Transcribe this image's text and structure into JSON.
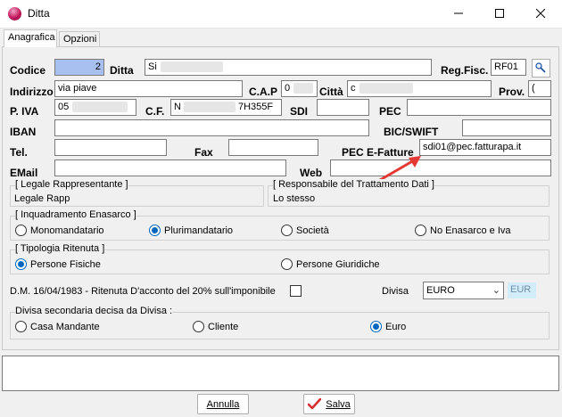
{
  "window": {
    "title": "Ditta"
  },
  "tabs": [
    {
      "label": "Anagrafica",
      "active": true
    },
    {
      "label": "Opzioni",
      "active": false
    }
  ],
  "labels": {
    "codice": "Codice",
    "ditta": "Ditta",
    "reg_fisc": "Reg.Fisc.",
    "indirizzo": "Indirizzo",
    "cap": "C.A.P",
    "citta": "Città",
    "prov": "Prov.",
    "piva": "P. IVA",
    "cf": "C.F.",
    "sdi": "SDI",
    "pec": "PEC",
    "iban": "IBAN",
    "bic": "BIC/SWIFT",
    "tel": "Tel.",
    "fax": "Fax",
    "pec_fatture": "PEC E-Fatture",
    "email": "EMail",
    "web": "Web"
  },
  "fields": {
    "codice": "2",
    "ditta": "Si",
    "reg_fisc": "RF01",
    "indirizzo": "via piave",
    "cap": "0",
    "citta": "c",
    "prov": "(",
    "piva": "05",
    "cf_start": "N",
    "cf_end": "7H355F",
    "sdi": "",
    "pec": "",
    "iban": "",
    "bic": "",
    "tel": "",
    "fax": "",
    "pec_fatture": "sdi01@pec.fatturapa.it",
    "email": "",
    "web": ""
  },
  "groups": {
    "legale": {
      "title": "[ Legale Rappresentante ]",
      "value": "Legale Rapp"
    },
    "responsabile": {
      "title": "[ Responsabile del Trattamento Dati ]",
      "value": "Lo stesso"
    },
    "enasarco": {
      "title": "[ Inquadramento Enasarco ]",
      "options": [
        "Monomandatario",
        "Plurimandatario",
        "Società",
        "No Enasarco e Iva"
      ],
      "selected": "Plurimandatario"
    },
    "ritenuta": {
      "title": "[ Tipologia Ritenuta ]",
      "options": [
        "Persone Fisiche",
        "Persone Giuridiche"
      ],
      "selected": "Persone Fisiche"
    },
    "divisa_secondaria": {
      "title": "Divisa secondaria decisa da Divisa :",
      "options": [
        "Casa Mandante",
        "Cliente",
        "Euro"
      ],
      "selected": "Euro"
    }
  },
  "ritenuta_dm": {
    "label": "D.M. 16/04/1983 - Ritenuta D'acconto del 20% sull'imponibile",
    "checked": false
  },
  "divisa": {
    "label": "Divisa",
    "value": "EURO",
    "code": "EUR"
  },
  "memo": "",
  "buttons": {
    "annulla": "Annulla",
    "salva": "Salva"
  },
  "annotation": {
    "arrow_color": "#e53935"
  },
  "icons": [
    "app-logo-icon",
    "minimize-icon",
    "maximize-icon",
    "close-icon",
    "lookup-icon",
    "salva-check-icon"
  ]
}
